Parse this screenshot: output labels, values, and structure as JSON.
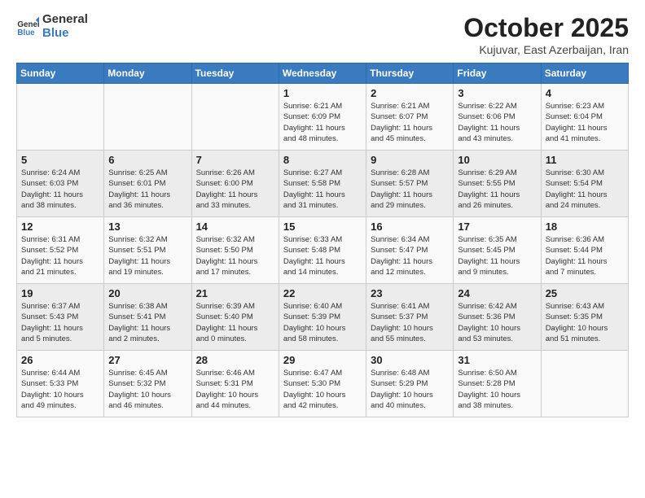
{
  "header": {
    "logo_general": "General",
    "logo_blue": "Blue",
    "month_title": "October 2025",
    "location": "Kujuvar, East Azerbaijan, Iran"
  },
  "weekdays": [
    "Sunday",
    "Monday",
    "Tuesday",
    "Wednesday",
    "Thursday",
    "Friday",
    "Saturday"
  ],
  "weeks": [
    [
      {
        "day": "",
        "info": ""
      },
      {
        "day": "",
        "info": ""
      },
      {
        "day": "",
        "info": ""
      },
      {
        "day": "1",
        "info": "Sunrise: 6:21 AM\nSunset: 6:09 PM\nDaylight: 11 hours\nand 48 minutes."
      },
      {
        "day": "2",
        "info": "Sunrise: 6:21 AM\nSunset: 6:07 PM\nDaylight: 11 hours\nand 45 minutes."
      },
      {
        "day": "3",
        "info": "Sunrise: 6:22 AM\nSunset: 6:06 PM\nDaylight: 11 hours\nand 43 minutes."
      },
      {
        "day": "4",
        "info": "Sunrise: 6:23 AM\nSunset: 6:04 PM\nDaylight: 11 hours\nand 41 minutes."
      }
    ],
    [
      {
        "day": "5",
        "info": "Sunrise: 6:24 AM\nSunset: 6:03 PM\nDaylight: 11 hours\nand 38 minutes."
      },
      {
        "day": "6",
        "info": "Sunrise: 6:25 AM\nSunset: 6:01 PM\nDaylight: 11 hours\nand 36 minutes."
      },
      {
        "day": "7",
        "info": "Sunrise: 6:26 AM\nSunset: 6:00 PM\nDaylight: 11 hours\nand 33 minutes."
      },
      {
        "day": "8",
        "info": "Sunrise: 6:27 AM\nSunset: 5:58 PM\nDaylight: 11 hours\nand 31 minutes."
      },
      {
        "day": "9",
        "info": "Sunrise: 6:28 AM\nSunset: 5:57 PM\nDaylight: 11 hours\nand 29 minutes."
      },
      {
        "day": "10",
        "info": "Sunrise: 6:29 AM\nSunset: 5:55 PM\nDaylight: 11 hours\nand 26 minutes."
      },
      {
        "day": "11",
        "info": "Sunrise: 6:30 AM\nSunset: 5:54 PM\nDaylight: 11 hours\nand 24 minutes."
      }
    ],
    [
      {
        "day": "12",
        "info": "Sunrise: 6:31 AM\nSunset: 5:52 PM\nDaylight: 11 hours\nand 21 minutes."
      },
      {
        "day": "13",
        "info": "Sunrise: 6:32 AM\nSunset: 5:51 PM\nDaylight: 11 hours\nand 19 minutes."
      },
      {
        "day": "14",
        "info": "Sunrise: 6:32 AM\nSunset: 5:50 PM\nDaylight: 11 hours\nand 17 minutes."
      },
      {
        "day": "15",
        "info": "Sunrise: 6:33 AM\nSunset: 5:48 PM\nDaylight: 11 hours\nand 14 minutes."
      },
      {
        "day": "16",
        "info": "Sunrise: 6:34 AM\nSunset: 5:47 PM\nDaylight: 11 hours\nand 12 minutes."
      },
      {
        "day": "17",
        "info": "Sunrise: 6:35 AM\nSunset: 5:45 PM\nDaylight: 11 hours\nand 9 minutes."
      },
      {
        "day": "18",
        "info": "Sunrise: 6:36 AM\nSunset: 5:44 PM\nDaylight: 11 hours\nand 7 minutes."
      }
    ],
    [
      {
        "day": "19",
        "info": "Sunrise: 6:37 AM\nSunset: 5:43 PM\nDaylight: 11 hours\nand 5 minutes."
      },
      {
        "day": "20",
        "info": "Sunrise: 6:38 AM\nSunset: 5:41 PM\nDaylight: 11 hours\nand 2 minutes."
      },
      {
        "day": "21",
        "info": "Sunrise: 6:39 AM\nSunset: 5:40 PM\nDaylight: 11 hours\nand 0 minutes."
      },
      {
        "day": "22",
        "info": "Sunrise: 6:40 AM\nSunset: 5:39 PM\nDaylight: 10 hours\nand 58 minutes."
      },
      {
        "day": "23",
        "info": "Sunrise: 6:41 AM\nSunset: 5:37 PM\nDaylight: 10 hours\nand 55 minutes."
      },
      {
        "day": "24",
        "info": "Sunrise: 6:42 AM\nSunset: 5:36 PM\nDaylight: 10 hours\nand 53 minutes."
      },
      {
        "day": "25",
        "info": "Sunrise: 6:43 AM\nSunset: 5:35 PM\nDaylight: 10 hours\nand 51 minutes."
      }
    ],
    [
      {
        "day": "26",
        "info": "Sunrise: 6:44 AM\nSunset: 5:33 PM\nDaylight: 10 hours\nand 49 minutes."
      },
      {
        "day": "27",
        "info": "Sunrise: 6:45 AM\nSunset: 5:32 PM\nDaylight: 10 hours\nand 46 minutes."
      },
      {
        "day": "28",
        "info": "Sunrise: 6:46 AM\nSunset: 5:31 PM\nDaylight: 10 hours\nand 44 minutes."
      },
      {
        "day": "29",
        "info": "Sunrise: 6:47 AM\nSunset: 5:30 PM\nDaylight: 10 hours\nand 42 minutes."
      },
      {
        "day": "30",
        "info": "Sunrise: 6:48 AM\nSunset: 5:29 PM\nDaylight: 10 hours\nand 40 minutes."
      },
      {
        "day": "31",
        "info": "Sunrise: 6:50 AM\nSunset: 5:28 PM\nDaylight: 10 hours\nand 38 minutes."
      },
      {
        "day": "",
        "info": ""
      }
    ]
  ]
}
